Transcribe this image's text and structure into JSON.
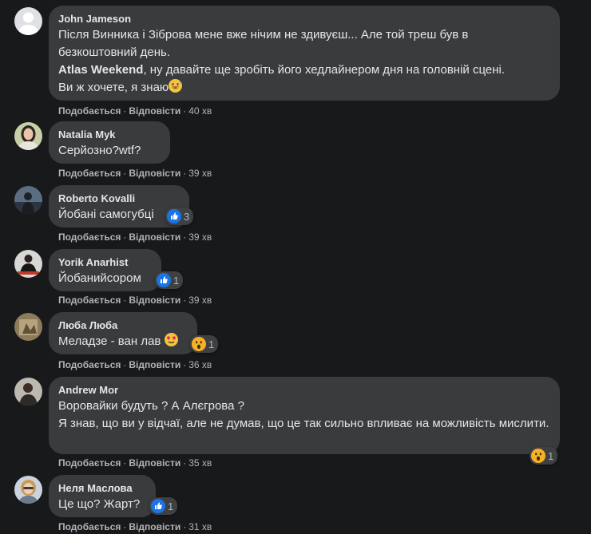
{
  "labels": {
    "like": "Подобається",
    "reply": "Відповісти",
    "dot": "·"
  },
  "colors": {
    "bubble": "#3a3b3c",
    "background": "#18191a",
    "text": "#e4e6eb",
    "secondary": "#b0b3b8",
    "like_blue": "#1b74e4",
    "wow_yellow": "#f7b125"
  },
  "comments": [
    {
      "author": "John Jameson",
      "lines": [
        "Після Винника і Зіброва мене вже нічим не здивуєш... Але той треш був в безкоштовний день."
      ],
      "mention": "Atlas Weekend",
      "mention_rest": ", ну давайте ще зробіть його хедлайнером дня на головній сцені.",
      "last": "Ви ж хочете, я знаю",
      "emoji": "grinning-sweat-emoji",
      "time": "40 хв"
    },
    {
      "author": "Natalia Myk",
      "text": "Серйозно?wtf?",
      "time": "39 хв"
    },
    {
      "author": "Roberto Kovalli",
      "text": "Йобані самогубці",
      "reaction": "like",
      "reaction_count": "3",
      "time": "39 хв"
    },
    {
      "author": "Yorik Anarhist",
      "text": "Йобанийсором",
      "reaction": "like",
      "reaction_count": "1",
      "time": "39 хв"
    },
    {
      "author": "Люба Люба",
      "text": "Меладзе - ван лав",
      "emoji": "heart-eyes-emoji",
      "reaction": "wow",
      "reaction_count": "1",
      "time": "36 хв"
    },
    {
      "author": "Andrew Mor",
      "text1": "Воровайки будуть ? А Алєгрова ?",
      "text2": "Я знав, що ви у відчаї, але не думав, що це так сильно впливає на можливість мислити.",
      "reaction": "wow",
      "reaction_count": "1",
      "time": "35 хв"
    },
    {
      "author": "Неля Маслова",
      "text": "Це що? Жарт?",
      "reaction": "like",
      "reaction_count": "1",
      "time": "31 хв"
    }
  ]
}
